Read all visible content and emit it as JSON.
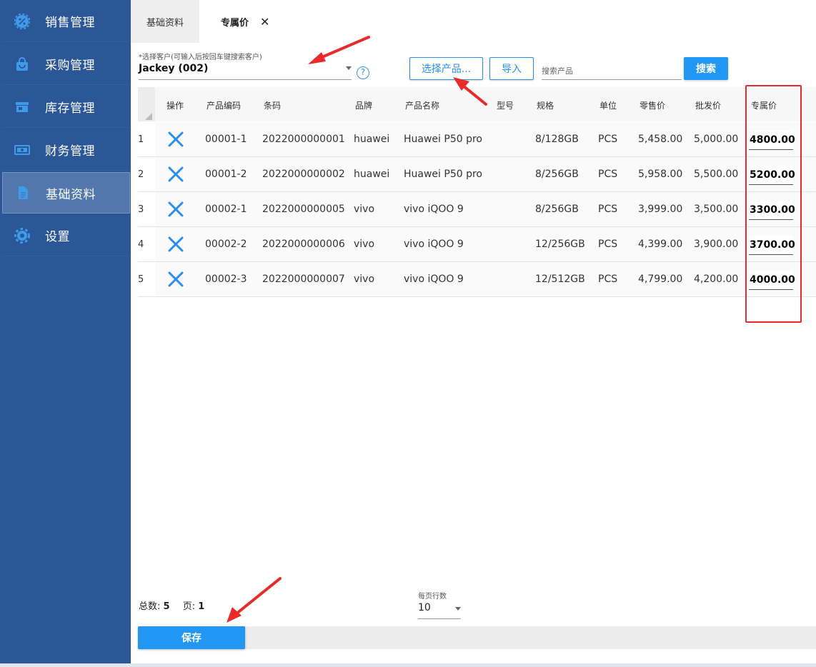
{
  "sidebar": {
    "items": [
      {
        "label": "销售管理",
        "icon": "percent-gear-icon"
      },
      {
        "label": "采购管理",
        "icon": "shopping-bag-icon"
      },
      {
        "label": "库存管理",
        "icon": "store-icon"
      },
      {
        "label": "财务管理",
        "icon": "money-icon"
      },
      {
        "label": "基础资料",
        "icon": "document-icon",
        "active": true
      },
      {
        "label": "设置",
        "icon": "gear-icon"
      }
    ]
  },
  "tabs": [
    {
      "label": "基础资料",
      "active": false
    },
    {
      "label": "专属价",
      "active": true,
      "close": "✕"
    }
  ],
  "customer": {
    "label": "*选择客户(可输入后按回车键搜索客户)",
    "value": "Jackey (002)",
    "help": "?"
  },
  "toolbar": {
    "select_products": "选择产品...",
    "import": "导入",
    "search_placeholder": "搜索产品",
    "search": "搜索"
  },
  "table": {
    "columns": [
      "操作",
      "产品编码",
      "条码",
      "品牌",
      "产品名称",
      "型号",
      "规格",
      "单位",
      "零售价",
      "批发价",
      "专属价"
    ],
    "rows": [
      {
        "num": "1",
        "code": "00001-1",
        "barcode": "2022000000001",
        "brand": "huawei",
        "name": "Huawei P50 pro",
        "model": "",
        "spec": "8/128GB",
        "unit": "PCS",
        "retail": "5,458.00",
        "wholesale": "5,000.00",
        "exclusive": "4800.00"
      },
      {
        "num": "2",
        "code": "00001-2",
        "barcode": "2022000000002",
        "brand": "huawei",
        "name": "Huawei P50 pro",
        "model": "",
        "spec": "8/256GB",
        "unit": "PCS",
        "retail": "5,958.00",
        "wholesale": "5,500.00",
        "exclusive": "5200.00"
      },
      {
        "num": "3",
        "code": "00002-1",
        "barcode": "2022000000005",
        "brand": "vivo",
        "name": "vivo iQOO 9",
        "model": "",
        "spec": "8/256GB",
        "unit": "PCS",
        "retail": "3,999.00",
        "wholesale": "3,500.00",
        "exclusive": "3300.00"
      },
      {
        "num": "4",
        "code": "00002-2",
        "barcode": "2022000000006",
        "brand": "vivo",
        "name": "vivo iQOO 9",
        "model": "",
        "spec": "12/256GB",
        "unit": "PCS",
        "retail": "4,399.00",
        "wholesale": "3,900.00",
        "exclusive": "3700.00"
      },
      {
        "num": "5",
        "code": "00002-3",
        "barcode": "2022000000007",
        "brand": "vivo",
        "name": "vivo iQOO 9",
        "model": "",
        "spec": "12/512GB",
        "unit": "PCS",
        "retail": "4,799.00",
        "wholesale": "4,200.00",
        "exclusive": "4000.00"
      }
    ]
  },
  "footer": {
    "total_label": "总数:",
    "total_value": "5",
    "page_label": "页:",
    "page_value": "1",
    "rows_per_page_label": "每页行数",
    "rows_per_page_value": "10",
    "save": "保存"
  },
  "colors": {
    "sidebar": "#2c5797",
    "primary": "#2196f3",
    "annotation": "#e82a2a"
  }
}
